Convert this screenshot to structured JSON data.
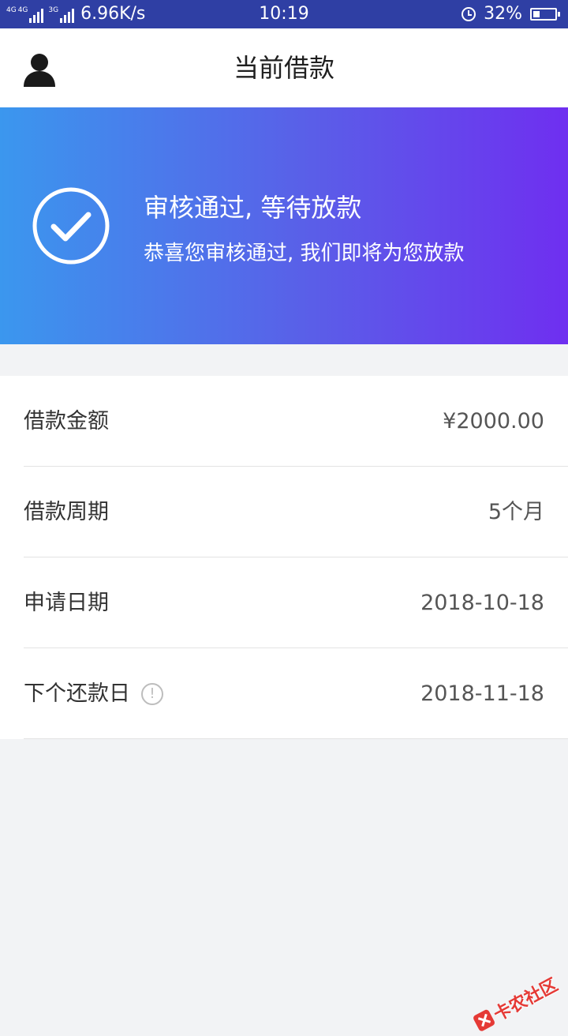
{
  "status_bar": {
    "signal_1_label": "4G",
    "signal_2_label": "4G",
    "signal_3_label": "3G",
    "net_speed": "6.96K/s",
    "time": "10:19",
    "battery_percent": "32%",
    "battery_level": 0.32,
    "icons": [
      "signal-icon",
      "alarm-icon",
      "battery-icon"
    ]
  },
  "header": {
    "title": "当前借款",
    "profile_icon": "person-icon"
  },
  "banner": {
    "title": "审核通过, 等待放款",
    "subtitle": "恭喜您审核通过, 我们即将为您放款",
    "icon": "check-circle-icon",
    "gradient_start": "#3b97ee",
    "gradient_end": "#6f2ff0"
  },
  "loan_info": {
    "rows": [
      {
        "label": "借款金额",
        "value": "¥2000.00"
      },
      {
        "label": "借款周期",
        "value": "5个月"
      },
      {
        "label": "申请日期",
        "value": "2018-10-18"
      },
      {
        "label": "下个还款日",
        "value": "2018-11-18",
        "tip_icon": "info-icon"
      }
    ]
  },
  "watermark": {
    "text": "卡农社区"
  }
}
